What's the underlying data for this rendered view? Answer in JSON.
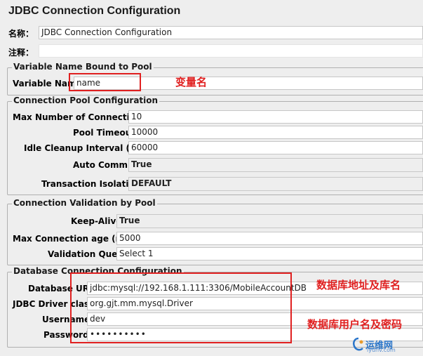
{
  "window": {
    "title": "JDBC Connection Configuration"
  },
  "name_row": {
    "label": "名称：",
    "value": "JDBC Connection Configuration"
  },
  "comment_row": {
    "label": "注释：",
    "value": ""
  },
  "variable_group": {
    "title": "Variable Name Bound to Pool",
    "label": "Variable Name:",
    "value": "name"
  },
  "pool_group": {
    "title": "Connection Pool Configuration",
    "max_conn_label": "Max Number of Connections:",
    "max_conn_value": "10",
    "timeout_label": "Pool Timeout:",
    "timeout_value": "10000",
    "idle_label": "Idle Cleanup Interval (ms):",
    "idle_value": "60000",
    "autocommit_label": "Auto Commit:",
    "autocommit_value": "True",
    "isolation_label": "Transaction Isolation:",
    "isolation_value": "DEFAULT"
  },
  "validation_group": {
    "title": "Connection Validation by Pool",
    "keepalive_label": "Keep-Alive:",
    "keepalive_value": "True",
    "maxage_label": "Max Connection age (ms):",
    "maxage_value": "5000",
    "query_label": "Validation Query:",
    "query_value": "Select 1"
  },
  "db_group": {
    "title": "Database Connection Configuration",
    "url_label": "Database URL:",
    "url_value": "jdbc:mysql://192.168.1.111:3306/MobileAccountDB",
    "driver_label": "JDBC Driver class:",
    "driver_value": "org.gjt.mm.mysql.Driver",
    "user_label": "Username:",
    "user_value": "dev",
    "pass_label": "Password:",
    "pass_value": "••••••••••"
  },
  "annotations": {
    "var_name": "变量名",
    "db_url": "数据库地址及库名",
    "db_user": "数据库用户名及密码"
  },
  "watermark": {
    "text": "运维网",
    "sub": "iyunv.com"
  },
  "colors": {
    "annotation_red": "#e02020",
    "panel_bg": "#eeeeee",
    "field_bg": "#ffffff"
  }
}
